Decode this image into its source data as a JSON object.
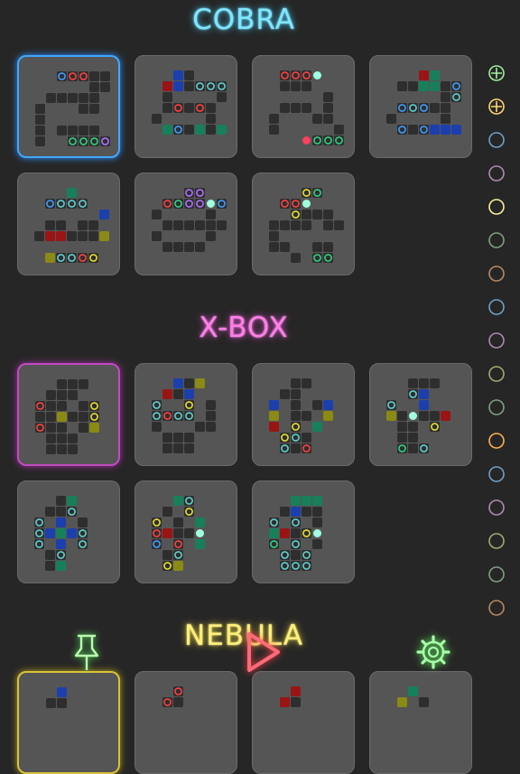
{
  "sections": [
    {
      "title": "COBRA"
    },
    {
      "title": "X-BOX"
    },
    {
      "title": "NEBULA"
    }
  ],
  "colors": {
    "cobra": "#7fe6ff",
    "xbox": "#ff7fe8",
    "nebula": "#ffef7a",
    "tile_bg": "#555555",
    "cell_dark": "#2e2e2e",
    "blue": "#1c3fae",
    "red": "#9a1414",
    "green": "#17805a",
    "yellow": "#8a8a14"
  },
  "side_buttons": [
    {
      "icon": "circle-plus-icon",
      "color": "#9df09d"
    },
    {
      "icon": "circle-plus-icon",
      "color": "#ffd870"
    },
    {
      "icon": "circle-icon",
      "color": "#6fa0c8"
    },
    {
      "icon": "circle-icon",
      "color": "#b08ab0"
    },
    {
      "icon": "circle-icon",
      "color": "#ffef9a"
    },
    {
      "icon": "circle-icon",
      "color": "#80a080"
    },
    {
      "icon": "circle-icon",
      "color": "#b88a60"
    },
    {
      "icon": "circle-icon",
      "color": "#6fa0c8"
    },
    {
      "icon": "circle-icon",
      "color": "#b08ab0"
    },
    {
      "icon": "circle-icon",
      "color": "#a8a870"
    },
    {
      "icon": "circle-icon",
      "color": "#80a080"
    },
    {
      "icon": "circle-icon",
      "color": "#ffb050"
    },
    {
      "icon": "circle-icon",
      "color": "#6fa0c8"
    },
    {
      "icon": "circle-icon",
      "color": "#b08ab0"
    },
    {
      "icon": "circle-icon",
      "color": "#a8a870"
    },
    {
      "icon": "circle-icon",
      "color": "#80a080"
    },
    {
      "icon": "circle-icon",
      "color": "#b88a60"
    }
  ],
  "bottom_buttons": [
    {
      "icon": "pin-icon",
      "color": "#baffb0"
    },
    {
      "icon": "play-icon",
      "color": "#ff6a78"
    },
    {
      "icon": "gear-icon",
      "color": "#a8ffa8"
    }
  ]
}
